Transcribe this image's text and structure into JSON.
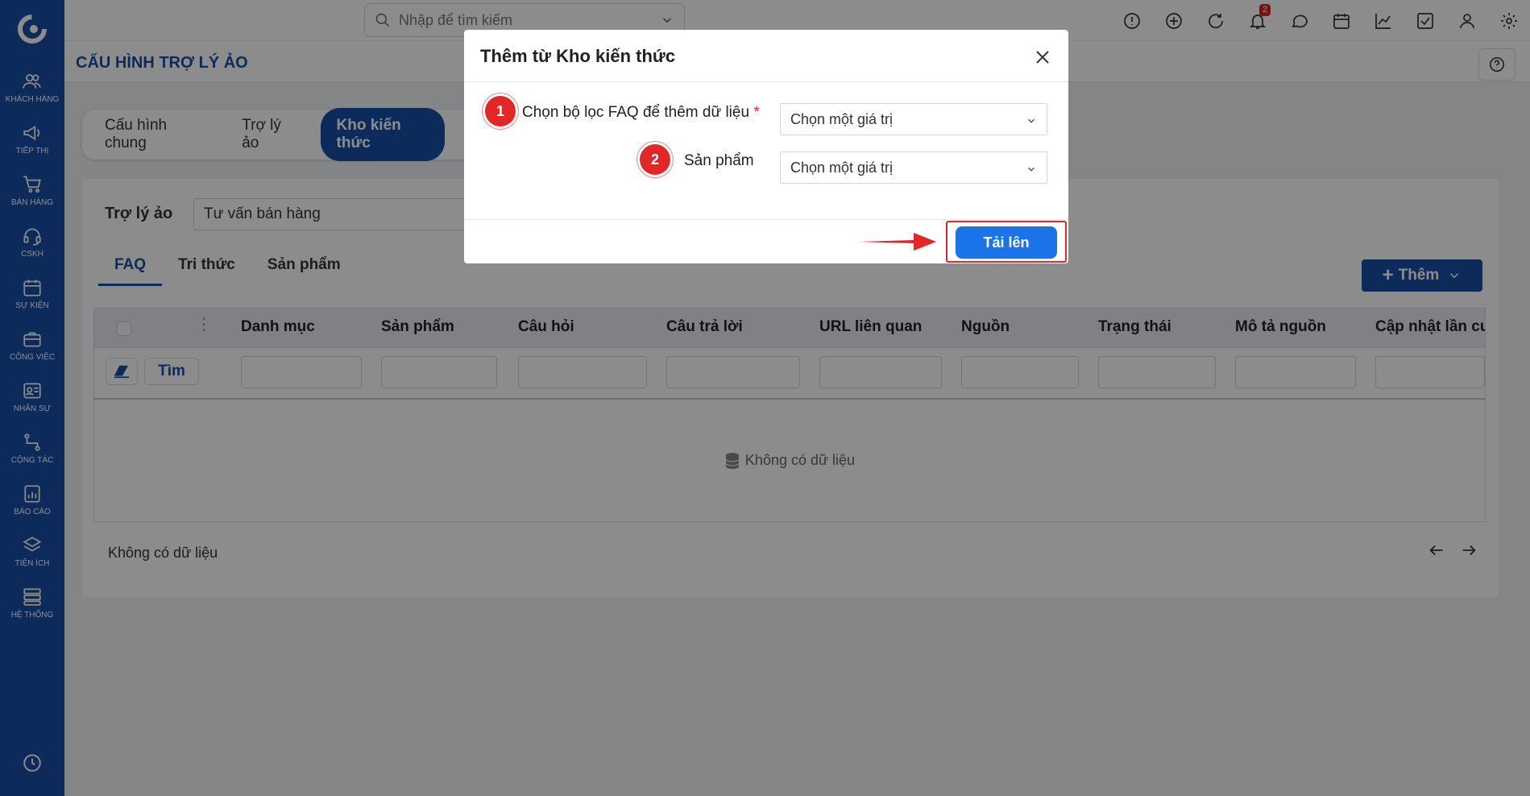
{
  "sidebar": {
    "items": [
      {
        "label": "KHÁCH HÀNG",
        "icon": "users-icon"
      },
      {
        "label": "TIẾP THỊ",
        "icon": "megaphone-icon"
      },
      {
        "label": "BÁN HÀNG",
        "icon": "cart-icon"
      },
      {
        "label": "CSKH",
        "icon": "headset-icon"
      },
      {
        "label": "SỰ KIỆN",
        "icon": "calendar-icon"
      },
      {
        "label": "CÔNG VIỆC",
        "icon": "briefcase-icon"
      },
      {
        "label": "NHÂN SỰ",
        "icon": "id-card-icon"
      },
      {
        "label": "CỘNG TÁC",
        "icon": "flow-icon"
      },
      {
        "label": "BÁO CÁO",
        "icon": "report-icon"
      },
      {
        "label": "TIỆN ÍCH",
        "icon": "layers-icon"
      },
      {
        "label": "HỆ THỐNG",
        "icon": "server-icon"
      }
    ]
  },
  "topbar": {
    "search_placeholder": "Nhập để tìm kiếm",
    "notification_count": "2"
  },
  "page": {
    "title": "CẤU HÌNH TRỢ LÝ ẢO",
    "tabs": [
      "Cấu hình chung",
      "Trợ lý ảo",
      "Kho kiến thức"
    ],
    "active_tab": "Kho kiến thức",
    "assistant_label": "Trợ lý ảo",
    "assistant_value": "Tư vấn bán hàng",
    "subtabs": [
      "FAQ",
      "Tri thức",
      "Sản phẩm"
    ],
    "active_subtab": "FAQ",
    "add_button": "Thêm"
  },
  "table": {
    "columns": [
      "Danh mục",
      "Sản phẩm",
      "Câu hỏi",
      "Câu trả lời",
      "URL liên quan",
      "Nguồn",
      "Trạng thái",
      "Mô tả nguồn",
      "Cập nhật lần cuố"
    ],
    "search_button": "Tìm",
    "empty_text": "Không có dữ liệu",
    "footer_text": "Không có dữ liệu"
  },
  "modal": {
    "title": "Thêm từ Kho kiến thức",
    "fields": [
      {
        "step": "1",
        "label": "Chọn bộ lọc FAQ để thêm dữ liệu",
        "required_mark": "*",
        "placeholder": "Chọn một giá trị"
      },
      {
        "step": "2",
        "label": "Sản phẩm",
        "placeholder": "Chọn một giá trị"
      }
    ],
    "submit_label": "Tải lên"
  },
  "colors": {
    "brand": "#174fa6",
    "primary_button": "#1a73e8",
    "annotation_red": "#e32626"
  }
}
